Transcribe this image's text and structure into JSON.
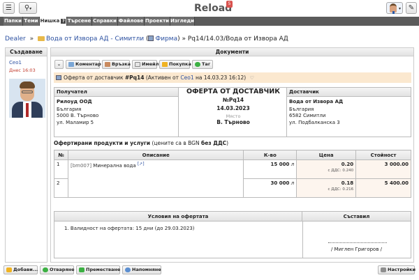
{
  "header": {
    "brand": "Reload",
    "badge": "5",
    "menu_icon": "hamburger-icon",
    "search_icon": "search-icon",
    "pin_icon": "pin-icon"
  },
  "nav": {
    "tabs": [
      "Папки",
      "Теми",
      "Нишка",
      "Търсене",
      "Справки",
      "Файлове",
      "Проекти",
      "Изгледи"
    ],
    "active": "Нишка",
    "help": "?"
  },
  "breadcrumb": {
    "root": "Dealer",
    "sep": "»",
    "folder": "Вода от Извора АД - Симитли",
    "firm": "Фирма",
    "current": "» Pq14/14.03/Вода от Извора АД"
  },
  "left_panel": {
    "title": "Създаване",
    "creator": "Ceo1",
    "created": "Днес 16:03"
  },
  "main_panel": {
    "title": "Документи",
    "toolbar": [
      "Коментар",
      "Връзка",
      "Имейл",
      "Покупка",
      "Таг"
    ],
    "info": {
      "prefix": "Оферта от доставчик",
      "number": "#Pq14",
      "mid": "(Активен от",
      "user": "Ceo1",
      "suffix": "на 14.03.23 16:12)"
    }
  },
  "recipient": {
    "label": "Получател",
    "name": "Рилоуд ООД",
    "country": "България",
    "city": "5000 В. Търново",
    "street": "ул. Маламир 5"
  },
  "document": {
    "title": "ОФЕРТА ОТ ДОСТАВЧИК",
    "number": "№Pq14",
    "date": "14.03.2023",
    "place_label": "Място",
    "place": "В. Търново"
  },
  "supplier": {
    "label": "Доставчик",
    "name": "Вода от Извора АД",
    "country": "България",
    "city": "6582 Симитли",
    "street": "ул. Подбалканска 3"
  },
  "products": {
    "caption_prefix": "Офертирани продукти и услуги",
    "caption_mid": "(цените са в BGN",
    "caption_bold": "без ДДС",
    "caption_suffix": ")",
    "columns": [
      "№",
      "Описание",
      "К-во",
      "Цена",
      "Стойност"
    ],
    "rows": [
      {
        "no": "1",
        "sku": "[bm007]",
        "desc": "Минерална вода",
        "link": "[↗]",
        "qty": "15 000",
        "unit": "л",
        "price": "0.20",
        "vat_label": "с ДДС:",
        "vat": "0.240",
        "amount": "3 000.00"
      },
      {
        "no": "2",
        "qty": "30 000",
        "unit": "л",
        "price": "0.18",
        "vat_label": "с ДДС:",
        "vat": "0.216",
        "amount": "5 400.00"
      }
    ]
  },
  "conditions": {
    "title": "Условия на офертата",
    "compiled": "Съставил",
    "item": "1. Валидност на офертата: 15 дни (до 29.03.2023)",
    "signer": "/ Миглен Григоров /"
  },
  "bottom_toolbar": [
    "Добави...",
    "Отваряне",
    "Преместване",
    "Напомняне",
    "Настройки"
  ]
}
